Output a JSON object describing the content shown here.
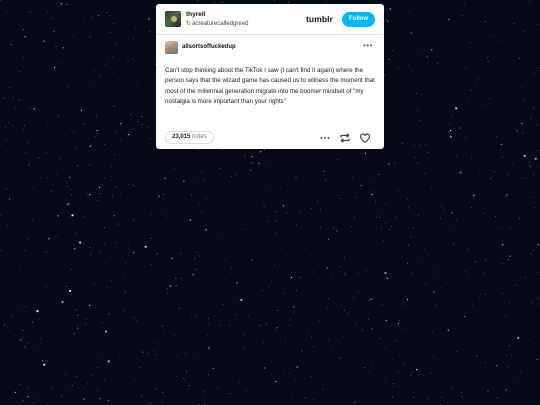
{
  "header": {
    "username": "thyrell",
    "reblogged_from": "acreaturecalledgreed",
    "logo": "tumblr",
    "follow_label": "Follow"
  },
  "post": {
    "author": "allsortsoffuckedup",
    "body": "Can't stop thinking about the TikTok I saw (I can't find it again) where the person says that the wizard game has caused us to witness the moment that most of the millennial generation migrate into the boomer mindset of \"my nostalgia is more important than your rights\""
  },
  "footer": {
    "notes_count": "23,015",
    "notes_label": "notes"
  },
  "icons": [
    "reblog-icon",
    "more-icon",
    "heart-icon"
  ],
  "colors": {
    "background": "#060918",
    "follow_button": "#00b8ff",
    "card": "#ffffff"
  }
}
